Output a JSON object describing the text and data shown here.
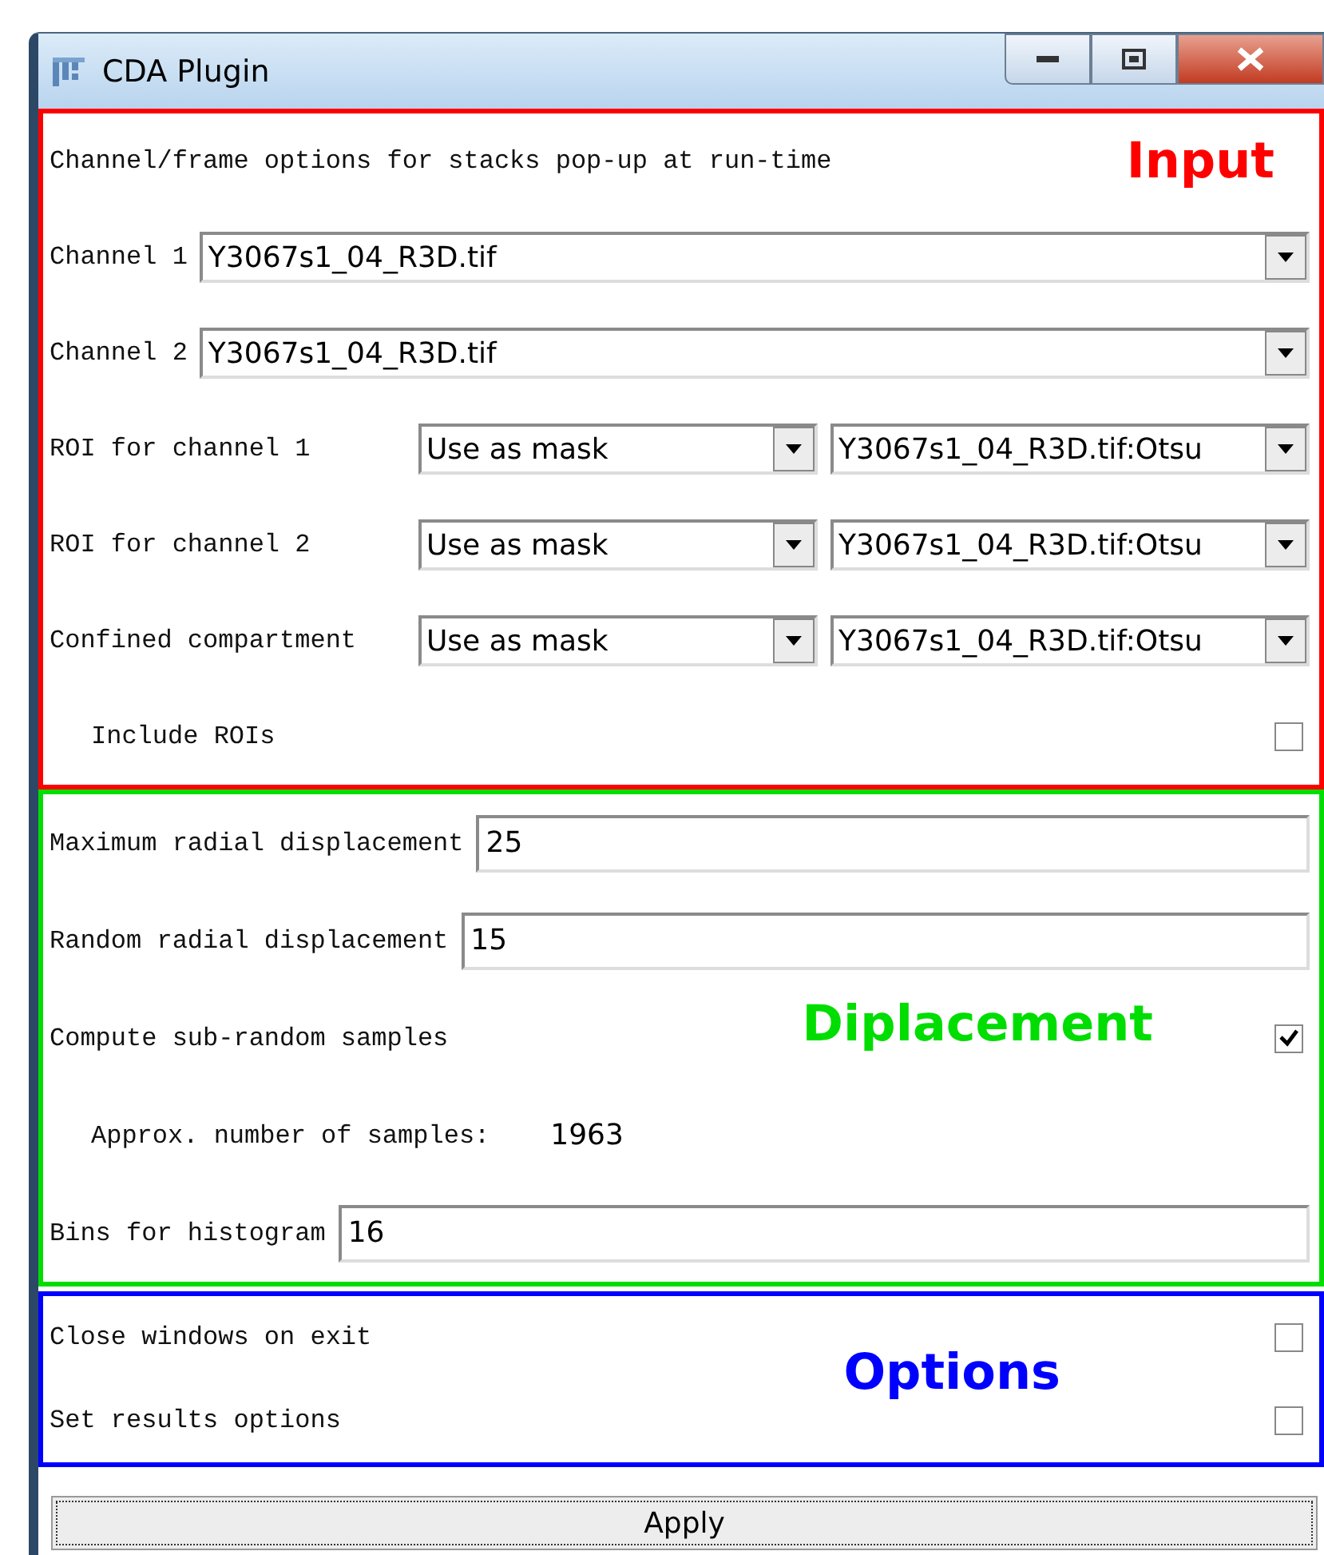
{
  "window": {
    "title": "CDA Plugin"
  },
  "sections": [
    {
      "label": "Input",
      "color": "#ff0000",
      "rows": [
        {
          "kind": "note",
          "label": "Channel/frame options for stacks pop-up at run-time"
        },
        {
          "kind": "combo",
          "label": "Channel 1",
          "dropdowns": [
            "Y3067s1_04_R3D.tif"
          ]
        },
        {
          "kind": "combo",
          "label": "Channel 2",
          "dropdowns": [
            "Y3067s1_04_R3D.tif"
          ]
        },
        {
          "kind": "combo",
          "label": "ROI for channel 1",
          "dropdowns": [
            "Use as mask",
            "Y3067s1_04_R3D.tif:Otsu"
          ]
        },
        {
          "kind": "combo",
          "label": "ROI for channel 2",
          "dropdowns": [
            "Use as mask",
            "Y3067s1_04_R3D.tif:Otsu"
          ]
        },
        {
          "kind": "combo",
          "label": "Confined compartment",
          "dropdowns": [
            "Use as mask",
            "Y3067s1_04_R3D.tif:Otsu"
          ]
        },
        {
          "kind": "checkbox",
          "label": "Include ROIs",
          "checked": false,
          "indent": true
        }
      ]
    },
    {
      "label": "Diplacement",
      "color": "#00dd00",
      "rows": [
        {
          "kind": "field",
          "label": "Maximum radial displacement",
          "value": "25"
        },
        {
          "kind": "field",
          "label": "Random radial displacement",
          "value": "15"
        },
        {
          "kind": "checkbox",
          "label": "Compute sub-random samples",
          "checked": true
        },
        {
          "kind": "info",
          "label": "Approx. number of samples:",
          "value": "1963"
        },
        {
          "kind": "field",
          "label": "Bins for histogram",
          "value": "16"
        }
      ]
    },
    {
      "label": "Options",
      "color": "#0000ff",
      "rows": [
        {
          "kind": "checkbox",
          "label": "Close windows on exit",
          "checked": false
        },
        {
          "kind": "checkbox",
          "label": "Set results options",
          "checked": false
        }
      ]
    }
  ],
  "apply": "Apply"
}
